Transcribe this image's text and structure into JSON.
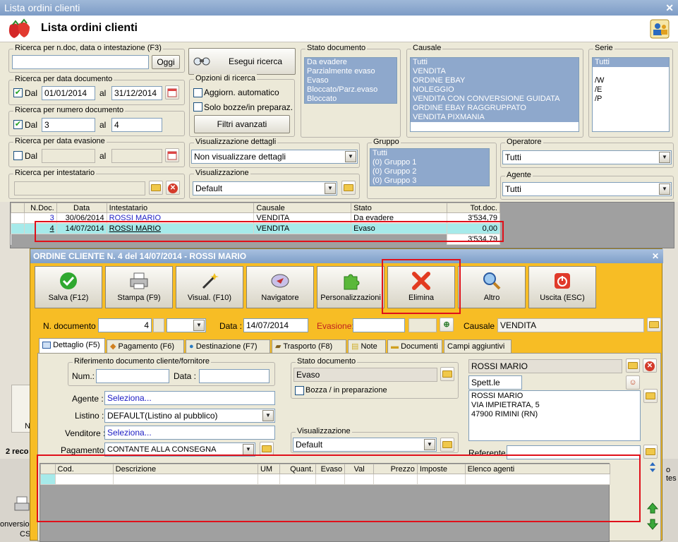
{
  "window": {
    "title": "Lista ordini clienti",
    "header_title": "Lista ordini clienti"
  },
  "search": {
    "ndoc_group": "Ricerca per n.doc, data o intestazione (F3)",
    "ndoc_value": "",
    "oggi": "Oggi",
    "esegui": "Esegui ricerca",
    "date_group": "Ricerca per data documento",
    "date_dal_label": "Dal",
    "date_from": "01/01/2014",
    "date_al_label": "al",
    "date_to": "31/12/2014",
    "num_group": "Ricerca per numero documento",
    "num_dal_label": "Dal",
    "num_from": "3",
    "num_al_label": "al",
    "num_to": "4",
    "evas_group": "Ricerca per data evasione",
    "evas_dal_label": "Dal",
    "evas_al_label": "al",
    "intest_group": "Ricerca per intestatario",
    "options_group": "Opzioni di ricerca",
    "opt_auto": "Aggiorn. automatico",
    "opt_bozze": "Solo bozze/in preparaz.",
    "filtri": "Filtri avanzati",
    "vis_dettagli_group": "Visualizzazione dettagli",
    "vis_dettagli_value": "Non visualizzare dettagli",
    "vis_group": "Visualizzazione",
    "vis_value": "Default"
  },
  "stato": {
    "title": "Stato documento",
    "items": [
      "Da evadere",
      "Parzialmente evaso",
      "Evaso",
      "Bloccato/Parz.evaso",
      "Bloccato"
    ]
  },
  "causale": {
    "title": "Causale",
    "items": [
      "Tutti",
      "VENDITA",
      "ORDINE EBAY",
      "NOLEGGIO",
      "VENDITA CON CONVERSIONE GUIDATA",
      "ORDINE EBAY RAGGRUPPATO",
      "VENDITA PIXMANIA"
    ]
  },
  "serie": {
    "title": "Serie",
    "items": [
      "Tutti",
      "",
      "/W",
      "/E",
      "/P"
    ]
  },
  "gruppo": {
    "title": "Gruppo",
    "items": [
      "Tutti",
      "(0) Gruppo 1",
      "(0) Gruppo 2",
      "(0) Gruppo 3"
    ]
  },
  "operatore": {
    "title": "Operatore",
    "value": "Tutti"
  },
  "agente_filter": {
    "title": "Agente",
    "value": "Tutti"
  },
  "orders": {
    "columns": [
      "N.Doc.",
      "Data",
      "Intestatario",
      "Causale",
      "Stato",
      "Tot.doc."
    ],
    "rows": [
      {
        "ndoc": "3",
        "data": "30/06/2014",
        "intest": "ROSSI MARIO",
        "causale": "VENDITA",
        "stato": "Da evadere",
        "tot": "3'534,79"
      },
      {
        "ndoc": "4",
        "data": "14/07/2014",
        "intest": "ROSSI MARIO",
        "causale": "VENDITA",
        "stato": "Evaso",
        "tot": "0,00"
      }
    ],
    "total": "3'534,79"
  },
  "background_bits": {
    "reco": "2 reco",
    "n": "N",
    "tes": "o tes",
    "conversion": "onversion",
    "cs": "CS"
  },
  "dialog": {
    "title": "ORDINE CLIENTE N. 4 del 14/07/2014 - ROSSI MARIO",
    "toolbar": [
      "Salva (F12)",
      "Stampa (F9)",
      "Visual. (F10)",
      "Navigatore",
      "Personalizzazioni",
      "Elimina",
      "Altro",
      "Uscita (ESC)"
    ],
    "ndoc_label": "N. documento :",
    "ndoc_value": "4",
    "data_label": "Data :",
    "data_value": "14/07/2014",
    "evasione_label": "Evasione:",
    "causale_label": "Causale :",
    "causale_value": "VENDITA",
    "tabs": [
      "Dettaglio (F5)",
      "Pagamento (F6)",
      "Destinazione (F7)",
      "Trasporto (F8)",
      "Note",
      "Documenti",
      "Campi aggiuntivi"
    ],
    "rif_group": "Riferimento documento cliente/fornitore",
    "num_label": "Num.:",
    "data2_label": "Data :",
    "agente_label": "Agente :",
    "agente_value": "Seleziona...",
    "listino_label": "Listino :",
    "listino_value": "DEFAULT(Listino al pubblico)",
    "venditore_label": "Venditore :",
    "venditore_value": "Seleziona...",
    "pagamento_label": "Pagamento :",
    "pagamento_value": "CONTANTE ALLA CONSEGNA",
    "stato_group": "Stato documento",
    "stato_value": "Evaso",
    "bozza_label": "Bozza / in preparazione",
    "vis_group": "Visualizzazione",
    "vis_value": "Default",
    "cliente_name": "ROSSI MARIO",
    "spett": "Spett.le",
    "address_lines": [
      "ROSSI MARIO",
      "VIA IMPIETRATA, 5",
      "47900 RIMINI (RN)"
    ],
    "referente_label": "Referente",
    "lines_columns": [
      "Cod.",
      "Descrizione",
      "UM",
      "Quant.",
      "Evaso",
      "Val",
      "Prezzo",
      "Imposte",
      "Elenco agenti"
    ]
  }
}
